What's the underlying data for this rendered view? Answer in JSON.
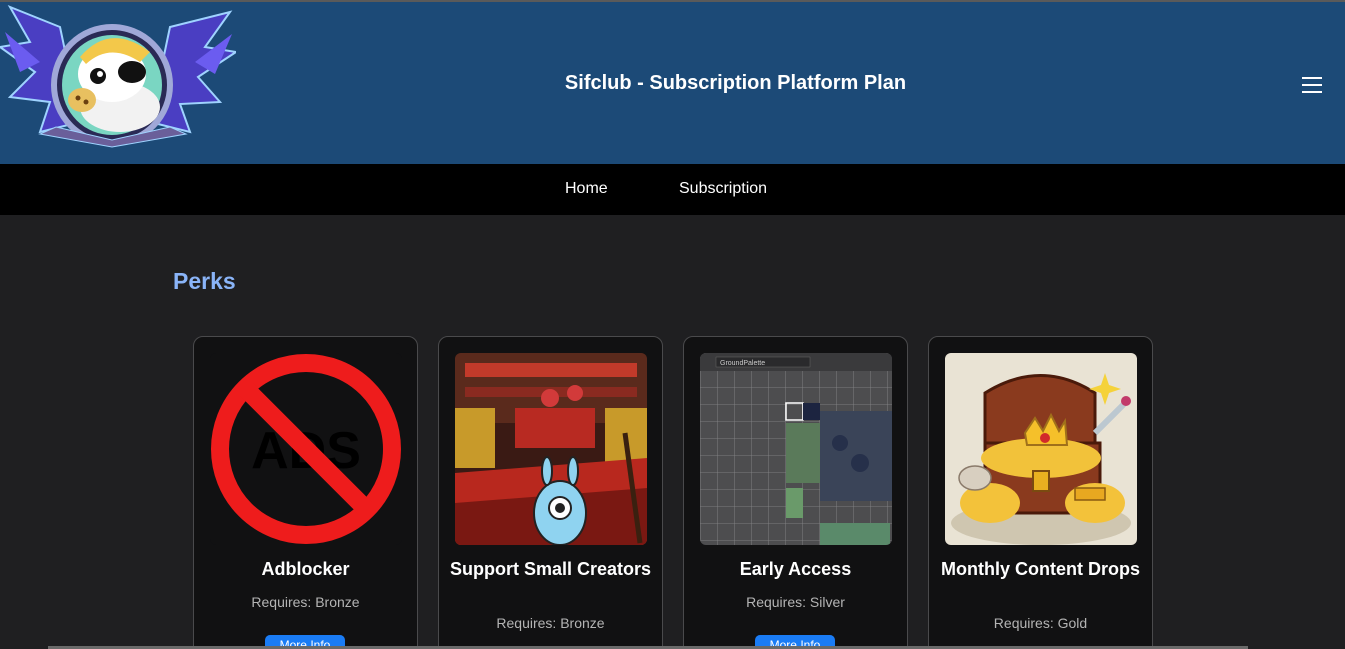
{
  "header": {
    "title": "Sifclub - Subscription Platform Plan",
    "logo_icon": "pirate-mascot-emblem-logo",
    "menu_icon": "hamburger-menu-icon"
  },
  "nav": {
    "items": [
      {
        "label": "Home"
      },
      {
        "label": "Subscription"
      }
    ]
  },
  "perks": {
    "heading": "Perks",
    "cards": [
      {
        "title": "Adblocker",
        "requirement": "Requires: Bronze",
        "button": "More Info",
        "image_icon": "no-ads-icon"
      },
      {
        "title": "Support Small Creators",
        "requirement": "Requires: Bronze",
        "image_icon": "game-scene-image"
      },
      {
        "title": "Early Access",
        "requirement": "Requires: Silver",
        "button": "More Info",
        "image_icon": "tile-palette-editor-image"
      },
      {
        "title": "Monthly Content Drops",
        "requirement": "Requires: Gold",
        "image_icon": "treasure-chest-image"
      }
    ]
  },
  "colors": {
    "header_bg": "#1c4a77",
    "nav_bg": "#000000",
    "page_bg": "#1f1f21",
    "accent": "#8ab4f8",
    "button": "#1a7cf5"
  }
}
